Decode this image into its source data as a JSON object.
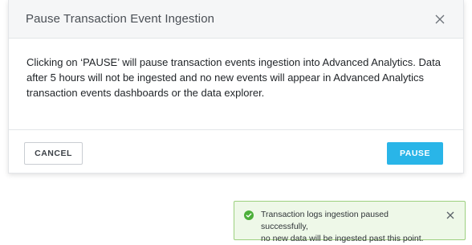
{
  "modal": {
    "title": "Pause Transaction Event Ingestion",
    "body": "Clicking on ‘PAUSE’ will pause transaction events ingestion into Advanced Analytics. Data after 5 hours  will not be ingested and no new events will appear in Advanced Analytics transaction events dashboards or the  data explorer.",
    "cancel_label": "CANCEL",
    "pause_label": "PAUSE"
  },
  "toast": {
    "line1": "Transaction logs ingestion paused successfully,",
    "line2": "no new data will be ingested past this point.",
    "status": "success"
  },
  "icons": {
    "close": "close-icon",
    "success": "check-circle-icon"
  },
  "colors": {
    "primary": "#29b5e8",
    "success_border": "#9dd07f",
    "success_bg": "#eef8e8",
    "success_icon": "#4caf3a"
  }
}
